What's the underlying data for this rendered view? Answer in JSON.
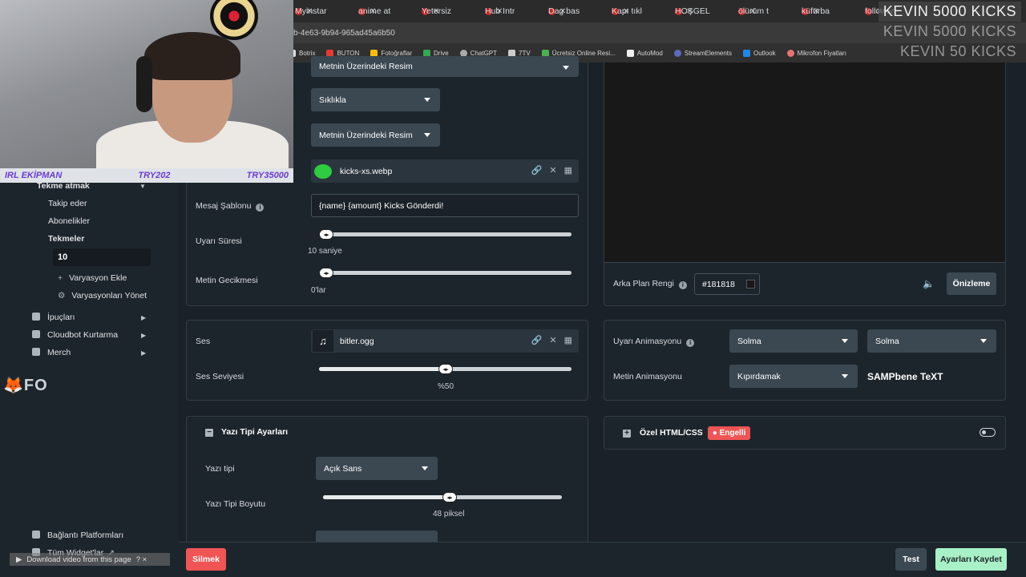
{
  "browser": {
    "tabs": [
      "Myinstar",
      "anime at",
      "Yetersiz",
      "Hub Intr",
      "Dag bas",
      "Kapı tıkl",
      "HOŞGEL",
      "ölürüm t",
      "küfürba",
      "follower"
    ],
    "url": "b-4e63-9b94-965ad45a6b50",
    "bookmarks": [
      "Botrix",
      "BUTON",
      "Fotoğraflar",
      "Drive",
      "ChatGPT",
      "7TV",
      "Ücretsiz Online Resi...",
      "AutoMod",
      "StreamElements",
      "Outlook",
      "Mikrofon Fiyatları"
    ]
  },
  "webcam": {
    "strip_left": "IRL EKİPMAN",
    "strip_mid": "TRY202",
    "strip_right": "TRY35000"
  },
  "overlay": {
    "kicks_line1": "KEVIN  5000 KICKS",
    "kicks_line2": "KEVIN  5000 KICKS",
    "kicks_line3": "KEVIN  50 KICKS"
  },
  "sidebar": {
    "section": "Tekme atmak",
    "items": [
      "Takip eder",
      "Abonelikler",
      "Tekmeler"
    ],
    "kicks_input_value": "10",
    "add_variation": "Varyasyon Ekle",
    "manage_variations": "Varyasyonları Yönet",
    "menu": [
      "İpuçları",
      "Cloudbot Kurtarma",
      "Merch"
    ],
    "logo_text": "FO",
    "bottom_links": [
      "Bağlantı Platformları",
      "Tüm Widget'lar"
    ]
  },
  "alert_settings": {
    "top_dropdown": "Metnin Üzerindeki Resim",
    "frequency_dropdown": "Sıklıkla",
    "layout_dropdown": "Metnin Üzerindeki Resim",
    "image_file": "kicks-xs.webp",
    "message_template_label": "Mesaj Şablonu",
    "message_template_value": "{name} {amount} Kicks Gönderdi!",
    "duration_label": "Uyarı Süresi",
    "duration_value": "10 saniye",
    "duration_fraction": 0.03,
    "text_delay_label": "Metin Gecikmesi",
    "text_delay_value": "0'lar",
    "text_delay_fraction": 0.0
  },
  "sound": {
    "label": "Ses",
    "file": "bitler.ogg",
    "volume_label": "Ses Seviyesi",
    "volume_value": "%50",
    "volume_fraction": 0.5
  },
  "font_settings": {
    "header": "Yazı Tipi Ayarları",
    "font_label": "Yazı tipi",
    "font_value": "Açık Sans",
    "size_label": "Yazı Tipi Boyutu",
    "size_value": "48 piksel",
    "size_fraction": 0.53
  },
  "preview": {
    "bg_label": "Arka Plan Rengi",
    "bg_value": "#181818",
    "preview_button": "Önizleme"
  },
  "animation": {
    "alert_anim_label": "Uyarı Animasyonu",
    "alert_anim_in": "Solma",
    "alert_anim_out": "Solma",
    "text_anim_label": "Metin Animasyonu",
    "text_anim_value": "Kıpırdamak",
    "text_anim_sample": "SAMPbene TeXT"
  },
  "custom_html": {
    "label": "Özel HTML/CSS",
    "badge": "Engelli"
  },
  "footer": {
    "delete_button": "Silmek",
    "test_button": "Test",
    "save_button": "Ayarları Kaydet"
  },
  "youtube_bar": {
    "text": "Download video from this page",
    "close": "? ×"
  },
  "colors": {
    "save_bg": "#a8f0c6",
    "delete_bg": "#f05454",
    "accent_purple": "#6a3bd1"
  }
}
